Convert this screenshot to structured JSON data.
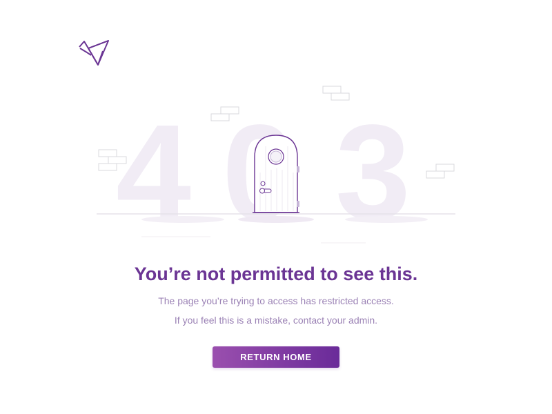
{
  "error": {
    "code_digits": [
      "4",
      "0",
      "3"
    ]
  },
  "content": {
    "headline": "You’re not permitted to see this.",
    "description_line1": "The page you’re trying to access has restricted access.",
    "description_line2": "If you feel this is a mistake, contact your admin."
  },
  "actions": {
    "return_home_label": "RETURN HOME"
  },
  "icons": {
    "logo": "origami-bird-logo-icon",
    "door": "door-icon"
  },
  "colors": {
    "accent": "#6b3594",
    "button_gradient_start": "#9a4fae",
    "button_gradient_end": "#6a2b99",
    "subtext": "#9b82b5",
    "digit_fill": "#f1ecf5",
    "background": "#ffffff"
  }
}
